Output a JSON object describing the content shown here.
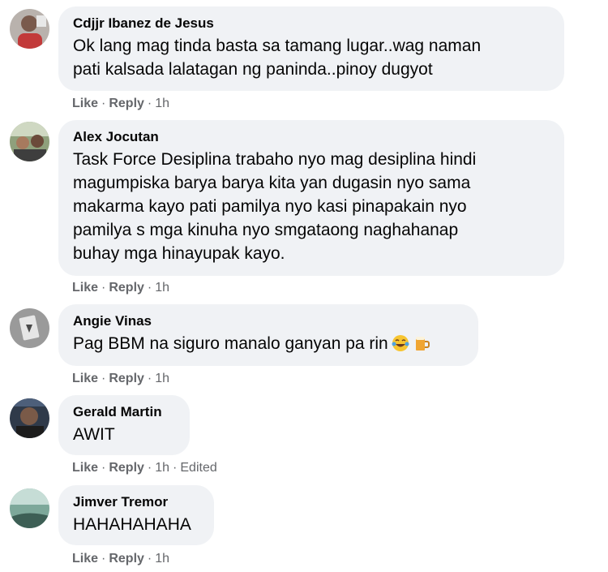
{
  "actions": {
    "like": "Like",
    "reply": "Reply",
    "separator": "·"
  },
  "comments": [
    {
      "author": "Cdjjr Ibanez de Jesus",
      "lines": [
        "Ok lang mag tinda basta sa tamang lugar..wag naman",
        "pati kalsada lalatagan ng paninda..pinoy dugyot"
      ],
      "time": "1h",
      "edited": ""
    },
    {
      "author": "Alex Jocutan",
      "lines": [
        "Task Force Desiplina trabaho nyo mag desiplina hindi",
        "magumpiska barya barya kita yan dugasin nyo sama",
        "makarma kayo pati pamilya nyo kasi pinapakain nyo",
        "pamilya s mga kinuha nyo smgataong naghahanap",
        "buhay mga hinayupak kayo."
      ],
      "time": "1h",
      "edited": ""
    },
    {
      "author": "Angie Vinas",
      "lines": [
        "Pag BBM na siguro manalo ganyan pa rin"
      ],
      "emojis": [
        "laughing-crying-face",
        "beer-mug"
      ],
      "time": "1h",
      "edited": ""
    },
    {
      "author": "Gerald Martin",
      "lines": [
        "AWIT"
      ],
      "time": "1h",
      "edited": "Edited"
    },
    {
      "author": "Jimver Tremor",
      "lines": [
        "HAHAHAHAHA"
      ],
      "time": "1h",
      "edited": ""
    }
  ]
}
